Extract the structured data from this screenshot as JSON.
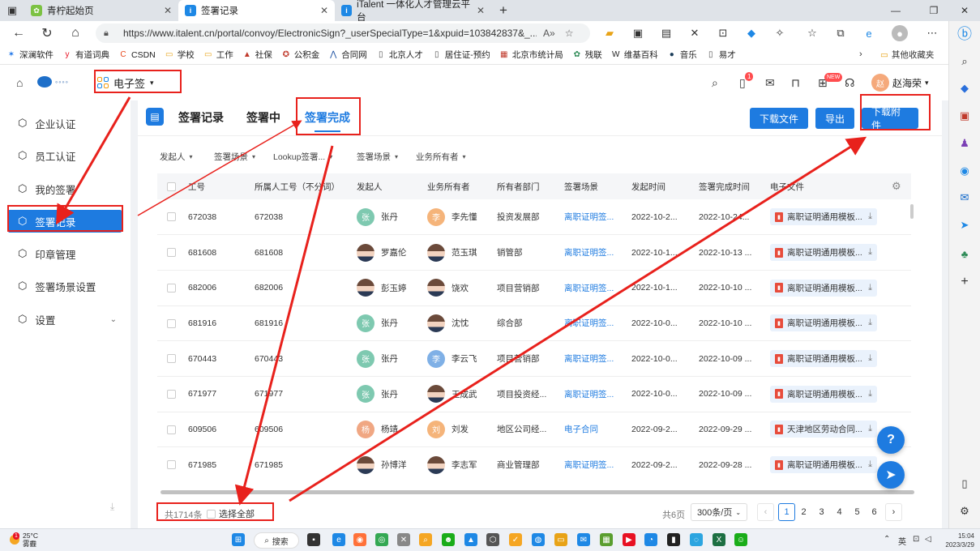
{
  "browser": {
    "tabs": [
      {
        "title": "青柠起始页",
        "fav_color": "#7cc243",
        "fav_glyph": "✿"
      },
      {
        "title": "签署记录",
        "fav_color": "#1e88e5",
        "fav_glyph": "i"
      },
      {
        "title": "iTalent 一体化人才管理云平台",
        "fav_color": "#1e88e5",
        "fav_glyph": "i"
      }
    ],
    "url": "https://www.italent.cn/portal/convoy/ElectronicSign?_userSpecialType=1&xpuid=103842837&_...",
    "bookmarks": [
      {
        "label": "深澜软件",
        "icon": "sl-icon",
        "color": "#1a73e8",
        "glyph": "✶"
      },
      {
        "label": "有道词典",
        "icon": "youdao-icon",
        "color": "#e81123",
        "glyph": "y"
      },
      {
        "label": "CSDN",
        "icon": "csdn-icon",
        "color": "#e8481c",
        "glyph": "C"
      },
      {
        "label": "学校",
        "icon": "folder-icon",
        "color": "#e8a317",
        "glyph": "▭"
      },
      {
        "label": "工作",
        "icon": "folder-icon",
        "color": "#e8a317",
        "glyph": "▭"
      },
      {
        "label": "社保",
        "icon": "shebao-icon",
        "color": "#c0392b",
        "glyph": "▲"
      },
      {
        "label": "公积金",
        "icon": "gjj-icon",
        "color": "#c0392b",
        "glyph": "✪"
      },
      {
        "label": "合同网",
        "icon": "ht-icon",
        "color": "#1a4fa0",
        "glyph": "⋀"
      },
      {
        "label": "北京人才",
        "icon": "page-icon",
        "color": "#555555",
        "glyph": "▯"
      },
      {
        "label": "居住证-预约",
        "icon": "page-icon",
        "color": "#555555",
        "glyph": "▯"
      },
      {
        "label": "北京市统计局",
        "icon": "tongji-icon",
        "color": "#c0392b",
        "glyph": "▦"
      },
      {
        "label": "残联",
        "icon": "canlian-icon",
        "color": "#2e8b57",
        "glyph": "✿"
      },
      {
        "label": "维基百科",
        "icon": "wiki-icon",
        "color": "#222222",
        "glyph": "W"
      },
      {
        "label": "音乐",
        "icon": "music-icon",
        "color": "#1c3d5a",
        "glyph": "●"
      },
      {
        "label": "易才",
        "icon": "page-icon",
        "color": "#555555",
        "glyph": "▯"
      }
    ],
    "other_bookmarks": "其他收藏夹"
  },
  "header": {
    "app_name": "电子签",
    "user_name": "赵海荣",
    "user_avatar": "赵",
    "notification_count": "1",
    "new_badge": "NEW"
  },
  "sidebar": {
    "items": [
      {
        "label": "企业认证"
      },
      {
        "label": "员工认证"
      },
      {
        "label": "我的签署"
      },
      {
        "label": "签署记录"
      },
      {
        "label": "印章管理"
      },
      {
        "label": "签署场景设置"
      },
      {
        "label": "设置"
      }
    ]
  },
  "main": {
    "tabs": [
      "签署记录",
      "签署中",
      "签署完成"
    ],
    "buttons": {
      "download_file": "下载文件",
      "export": "导出",
      "download_attachment": "下载附件"
    },
    "filters": [
      "发起人",
      "签署场景",
      "Lookup签署...",
      "签署场景",
      "业务所有者"
    ],
    "columns": [
      "工号",
      "所属人工号（不分词）",
      "发起人",
      "业务所有者",
      "所有者部门",
      "签署场景",
      "发起时间",
      "签署完成时间",
      "电子文件"
    ],
    "rows": [
      {
        "id": "672038",
        "owner_id": "672038",
        "initiator": "张丹",
        "init_av": "张",
        "init_color": "#7ec9b0",
        "owner": "李先懂",
        "owner_av": "李",
        "owner_color": "#f5b47a",
        "dept": "投资发展部",
        "scene": "离职证明签...",
        "start": "2022-10-2...",
        "done": "2022-10-24...",
        "file": "离职证明通用模板..."
      },
      {
        "id": "681608",
        "owner_id": "681608",
        "initiator": "罗嘉伦",
        "init_av": "",
        "init_color": "",
        "owner": "范玉琪",
        "owner_av": "",
        "owner_color": "",
        "dept": "销管部",
        "scene": "离职证明签...",
        "start": "2022-10-1...",
        "done": "2022-10-13 ...",
        "file": "离职证明通用模板..."
      },
      {
        "id": "682006",
        "owner_id": "682006",
        "initiator": "彭玉婷",
        "init_av": "",
        "init_color": "",
        "owner": "饶欢",
        "owner_av": "",
        "owner_color": "",
        "dept": "项目营销部",
        "scene": "离职证明签...",
        "start": "2022-10-1...",
        "done": "2022-10-10 ...",
        "file": "离职证明通用模板..."
      },
      {
        "id": "681916",
        "owner_id": "681916",
        "initiator": "张丹",
        "init_av": "张",
        "init_color": "#7ec9b0",
        "owner": "沈忱",
        "owner_av": "",
        "owner_color": "",
        "dept": "综合部",
        "scene": "离职证明签...",
        "start": "2022-10-0...",
        "done": "2022-10-10 ...",
        "file": "离职证明通用模板..."
      },
      {
        "id": "670443",
        "owner_id": "670443",
        "initiator": "张丹",
        "init_av": "张",
        "init_color": "#7ec9b0",
        "owner": "李云飞",
        "owner_av": "李",
        "owner_color": "#7fb0e6",
        "dept": "项目营销部",
        "scene": "离职证明签...",
        "start": "2022-10-0...",
        "done": "2022-10-09 ...",
        "file": "离职证明通用模板..."
      },
      {
        "id": "671977",
        "owner_id": "671977",
        "initiator": "张丹",
        "init_av": "张",
        "init_color": "#7ec9b0",
        "owner": "王成武",
        "owner_av": "",
        "owner_color": "",
        "dept": "项目投资经...",
        "scene": "离职证明签...",
        "start": "2022-10-0...",
        "done": "2022-10-09 ...",
        "file": "离职证明通用模板..."
      },
      {
        "id": "609506",
        "owner_id": "609506",
        "initiator": "杨靖",
        "init_av": "杨",
        "init_color": "#f0a783",
        "owner": "刘发",
        "owner_av": "刘",
        "owner_color": "#f5b47a",
        "dept": "地区公司经...",
        "scene": "电子合同",
        "start": "2022-09-2...",
        "done": "2022-09-29 ...",
        "file": "天津地区劳动合同..."
      },
      {
        "id": "671985",
        "owner_id": "671985",
        "initiator": "孙博洋",
        "init_av": "",
        "init_color": "",
        "owner": "李志军",
        "owner_av": "",
        "owner_color": "",
        "dept": "商业管理部",
        "scene": "离职证明签...",
        "start": "2022-09-2...",
        "done": "2022-09-28 ...",
        "file": "离职证明通用模板..."
      }
    ],
    "footer": {
      "total": "共1714条",
      "select_all": "选择全部",
      "pages": "共6页",
      "page_size": "300条/页",
      "page_numbers": [
        "1",
        "2",
        "3",
        "4",
        "5",
        "6"
      ],
      "current_page": "1"
    }
  },
  "taskbar": {
    "temperature": "25°C",
    "weather": "雾霾",
    "weather_badge": "1",
    "search": "搜索",
    "ime": "英",
    "time": "15:04",
    "date": "2023/3/29"
  },
  "colors": {
    "accent": "#1e7be0",
    "annotation": "#e8211c"
  }
}
